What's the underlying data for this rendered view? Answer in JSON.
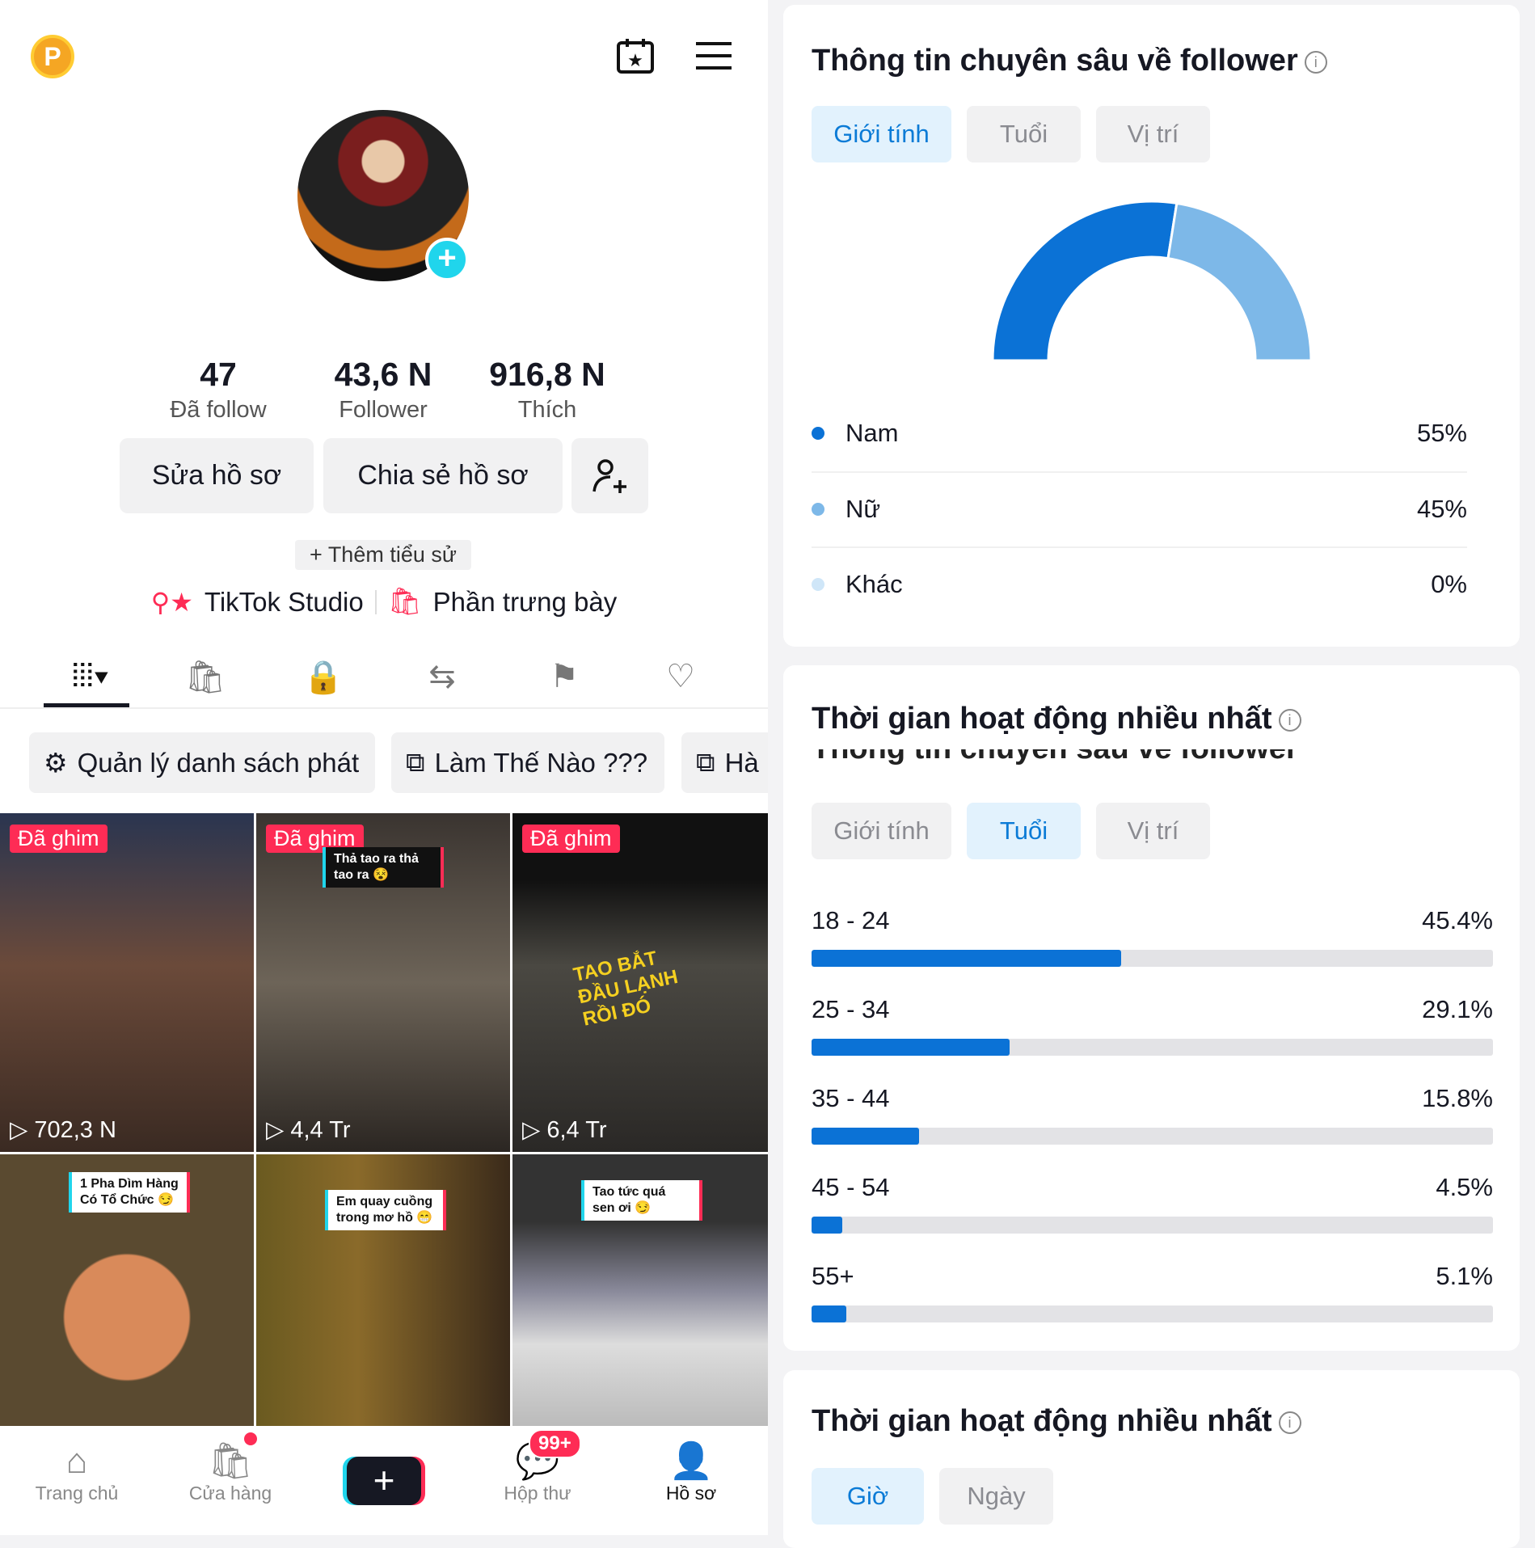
{
  "profile": {
    "coin_label": "P",
    "stats": [
      {
        "value": "47",
        "label": "Đã follow"
      },
      {
        "value": "43,6 N",
        "label": "Follower"
      },
      {
        "value": "916,8 N",
        "label": "Thích"
      }
    ],
    "edit_label": "Sửa hồ sơ",
    "share_label": "Chia sẻ hồ sơ",
    "bio_label": "+ Thêm tiểu sử",
    "studio_label": "TikTok Studio",
    "showcase_label": "Phần trưng bày"
  },
  "tabs": [
    "videos-icon",
    "shop-icon",
    "lock-icon",
    "repost-icon",
    "saved-icon",
    "liked-icon"
  ],
  "playlists": [
    "Quản lý danh sách phát",
    "Làm Thế Nào ???",
    "Hà"
  ],
  "videos": [
    {
      "pinned": "Đã ghim",
      "views": "702,3 N",
      "caption": ""
    },
    {
      "pinned": "Đã ghim",
      "views": "4,4 Tr",
      "caption": "Thả tao ra thả tao ra 😵"
    },
    {
      "pinned": "Đã ghim",
      "views": "6,4 Tr",
      "caption": "TAO BẮT ĐẦU LẠNH RỒI ĐÓ"
    },
    {
      "pinned": "",
      "views": "",
      "caption": "1 Pha Dìm Hàng Có Tổ Chức 😏"
    },
    {
      "pinned": "",
      "views": "",
      "caption": "Em quay cuồng trong mơ hồ 😁"
    },
    {
      "pinned": "",
      "views": "",
      "caption": "Tao tức quá sen ơi 😏"
    }
  ],
  "nav": {
    "items": [
      {
        "label": "Trang chủ",
        "icon": "home-icon"
      },
      {
        "label": "Cửa hàng",
        "icon": "shop-icon"
      },
      {
        "label": "",
        "icon": "create-icon"
      },
      {
        "label": "Hộp thư",
        "icon": "inbox-icon",
        "badge": "99+"
      },
      {
        "label": "Hồ sơ",
        "icon": "profile-icon"
      }
    ]
  },
  "insights": {
    "title": "Thông tin chuyên sâu về follower",
    "tabs": [
      "Giới tính",
      "Tuổi",
      "Vị trí"
    ],
    "active_tab": "Giới tính"
  },
  "age_card": {
    "title": "Thời gian hoạt động nhiều nhất",
    "ghost_title": "Thông tin chuyên sâu về follower",
    "tabs": [
      "Giới tính",
      "Tuổi",
      "Vị trí"
    ],
    "active_tab": "Tuổi"
  },
  "time_card": {
    "title": "Thời gian hoạt động nhiều nhất",
    "tabs": [
      "Giờ",
      "Ngày"
    ],
    "active_tab": "Giờ"
  },
  "chart_data": [
    {
      "type": "pie",
      "variant": "half-donut",
      "categories": [
        "Nam",
        "Nữ",
        "Khác"
      ],
      "values": [
        55,
        45,
        0
      ],
      "labels": [
        "55%",
        "45%",
        "0%"
      ],
      "colors": [
        "#0b72d6",
        "#7db8e8",
        "#cfe6f8"
      ]
    },
    {
      "type": "bar",
      "orientation": "horizontal",
      "categories": [
        "18 - 24",
        "25 - 34",
        "35 - 44",
        "45 - 54",
        "55+"
      ],
      "values": [
        45.4,
        29.1,
        15.8,
        4.5,
        5.1
      ],
      "labels": [
        "45.4%",
        "29.1%",
        "15.8%",
        "4.5%",
        "5.1%"
      ],
      "xlim": [
        0,
        100
      ],
      "color": "#0b72d6"
    }
  ]
}
